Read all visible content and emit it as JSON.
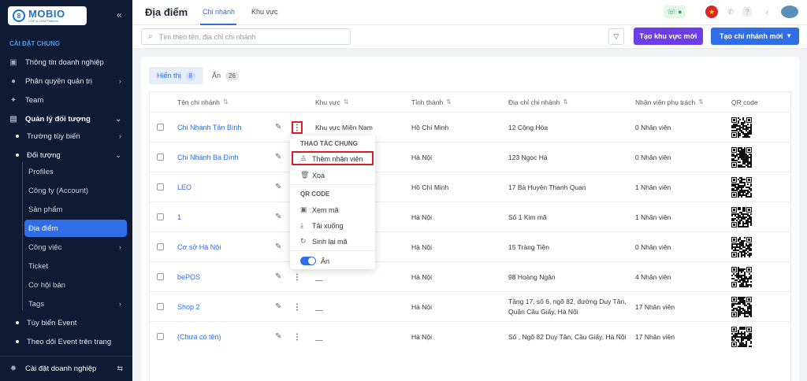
{
  "sidebar": {
    "logo_name": "MOBIO",
    "logo_sub": "CDP & CEM Platform",
    "section": "CÀI ĐẶT CHUNG",
    "items": [
      {
        "label": "Thông tin doanh nghiệp",
        "icon": "building-icon"
      },
      {
        "label": "Phân quyền quản trị",
        "icon": "user-shield-icon"
      },
      {
        "label": "Team",
        "icon": "team-icon"
      },
      {
        "label": "Quản lý đối tượng",
        "icon": "database-icon"
      }
    ],
    "sub_items": [
      "Trường tùy biến",
      "Đối tượng"
    ],
    "leaf_items": [
      "Profiles",
      "Công ty (Account)",
      "Sản phẩm",
      "Địa điểm",
      "Công việc",
      "Ticket",
      "Cơ hội bán",
      "Tags"
    ],
    "bottom_sub_items": [
      "Tùy biến Event",
      "Theo dõi Event trên trang"
    ],
    "footer": "Cài đặt doanh nghiệp"
  },
  "header": {
    "title": "Địa điểm",
    "tabs": [
      "Chi nhánh",
      "Khu vực"
    ]
  },
  "toolbar": {
    "search_placeholder": "Tìm theo tên, địa chỉ chi nhánh",
    "create_region": "Tạo khu vực mới",
    "create_branch": "Tạo chi nhánh mới"
  },
  "filters": {
    "shown_label": "Hiển thị",
    "shown_count": "8",
    "hidden_label": "Ẩn",
    "hidden_count": "26"
  },
  "table": {
    "columns": [
      "Tên chi nhánh",
      "Khu vực",
      "Tỉnh thành",
      "Địa chỉ chi nhánh",
      "Nhân viên phụ trách",
      "QR code"
    ],
    "rows": [
      {
        "name": "Chi Nhánh Tân Bình",
        "region": "Khu vực Miền Nam",
        "province": "Hồ Chí Minh",
        "address": "12 Cộng Hòa",
        "staff": "0 Nhân viên"
      },
      {
        "name": "Chi Nhánh Ba Đình",
        "region": "",
        "province": "Hà Nội",
        "address": "123 Ngọc Hà",
        "staff": "0 Nhân viên"
      },
      {
        "name": "LEO",
        "region": "",
        "province": "Hồ Chí Minh",
        "address": "17 Bà Huyện Thanh Quan",
        "staff": "1 Nhân viên"
      },
      {
        "name": "1",
        "region": "",
        "province": "Hà Nội",
        "address": "Số 1 Kim mã",
        "staff": "1 Nhân viên"
      },
      {
        "name": "Cơ sở Hà Nội",
        "region": "",
        "province": "Hà Nội",
        "address": "15 Tràng Tiền",
        "staff": "0 Nhân viên"
      },
      {
        "name": "bePOS",
        "region": "__",
        "province": "Hà Nội",
        "address": "98 Hoàng Ngân",
        "staff": "4 Nhân viên"
      },
      {
        "name": "Shop 2",
        "region": "__",
        "province": "Hà Nội",
        "address": "Tầng 17, số 6, ngõ 82, đường Duy Tân, Quận Cầu Giấy, Hà Nội",
        "staff": "17 Nhân viên"
      },
      {
        "name": "(Chưa có tên)",
        "region": "__",
        "province": "Hà Nội",
        "address": "Số , Ngõ 82 Duy Tân, Cầu Giấy, Hà Nội",
        "staff": "17 Nhân viên"
      }
    ]
  },
  "menu": {
    "group1": "THAO TÁC CHUNG",
    "add_staff": "Thêm nhân viên",
    "delete": "Xoá",
    "group2": "QR CODE",
    "view_code": "Xem mã",
    "download": "Tải xuống",
    "regenerate": "Sinh lại mã",
    "hide": "Ẩn"
  },
  "colors": {
    "primary": "#2f6ee6",
    "purple": "#6d3ee8",
    "sidebar": "#0f1b35",
    "highlight": "#d61f26"
  }
}
